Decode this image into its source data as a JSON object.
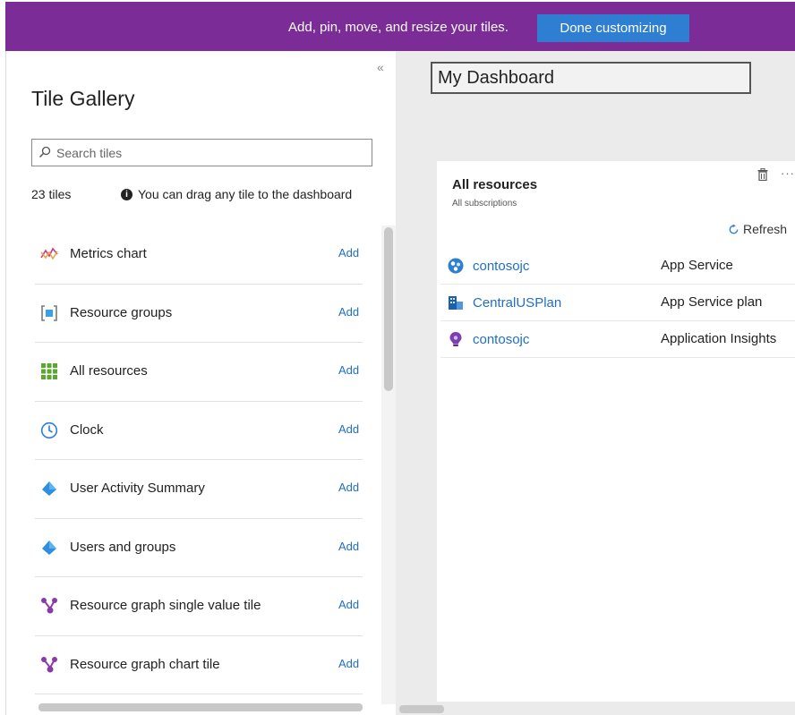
{
  "banner": {
    "text": "Add, pin, move, and resize your tiles.",
    "done_button": "Done customizing"
  },
  "gallery": {
    "collapse_glyph": "«",
    "title": "Tile Gallery",
    "search_placeholder": "Search tiles",
    "count": "23 tiles",
    "hint": "You can drag any tile to the dashboard",
    "items": [
      {
        "label": "Metrics chart",
        "action": "Add",
        "icon": "metrics-chart-icon"
      },
      {
        "label": "Resource groups",
        "action": "Add",
        "icon": "resource-groups-icon"
      },
      {
        "label": "All resources",
        "action": "Add",
        "icon": "all-resources-icon"
      },
      {
        "label": "Clock",
        "action": "Add",
        "icon": "clock-icon"
      },
      {
        "label": "User Activity Summary",
        "action": "Add",
        "icon": "user-activity-icon"
      },
      {
        "label": "Users and groups",
        "action": "Add",
        "icon": "users-groups-icon"
      },
      {
        "label": "Resource graph single value tile",
        "action": "Add",
        "icon": "resource-graph-icon"
      },
      {
        "label": "Resource graph chart tile",
        "action": "Add",
        "icon": "resource-graph-icon"
      }
    ]
  },
  "dashboard": {
    "title": "My Dashboard",
    "tile": {
      "title": "All resources",
      "subtitle": "All subscriptions",
      "refresh": "Refresh",
      "more": "···",
      "rows": [
        {
          "name": "contosojc",
          "type": "App Service",
          "icon": "app-service-icon"
        },
        {
          "name": "CentralUSPlan",
          "type": "App Service plan",
          "icon": "app-service-plan-icon"
        },
        {
          "name": "contosojc",
          "type": "Application Insights",
          "icon": "app-insights-icon"
        }
      ]
    }
  },
  "colors": {
    "banner": "#7b2c96",
    "button": "#2e7fd2",
    "link": "#1f6fc5"
  }
}
